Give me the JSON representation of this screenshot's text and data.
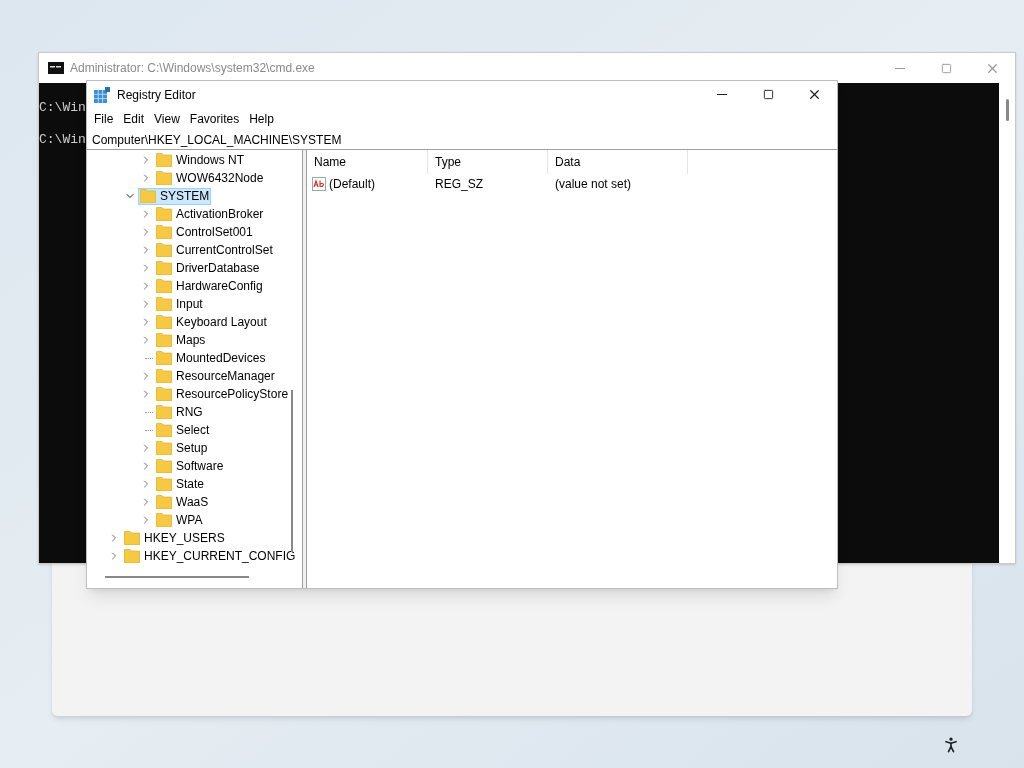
{
  "console_window": {
    "title": "Administrator: C:\\Windows\\system32\\cmd.exe",
    "lines": [
      "C:\\Win",
      "C:\\Win"
    ]
  },
  "registry_window": {
    "title": "Registry Editor",
    "menu": [
      "File",
      "Edit",
      "View",
      "Favorites",
      "Help"
    ],
    "address": "Computer\\HKEY_LOCAL_MACHINE\\SYSTEM",
    "tree": {
      "items": [
        {
          "children": [
            {
              "children": [
                {
                  "label": "Windows NT",
                  "expandable": true,
                  "expanded": false,
                  "selected": false
                },
                {
                  "label": "WOW6432Node",
                  "expandable": true,
                  "expanded": false,
                  "selected": false
                }
              ]
            },
            {
              "label": "SYSTEM",
              "expandable": true,
              "expanded": true,
              "selected": true,
              "children": [
                {
                  "label": "ActivationBroker",
                  "expandable": true,
                  "expanded": false,
                  "selected": false
                },
                {
                  "label": "ControlSet001",
                  "expandable": true,
                  "expanded": false,
                  "selected": false
                },
                {
                  "label": "CurrentControlSet",
                  "expandable": true,
                  "expanded": false,
                  "selected": false
                },
                {
                  "label": "DriverDatabase",
                  "expandable": true,
                  "expanded": false,
                  "selected": false
                },
                {
                  "label": "HardwareConfig",
                  "expandable": true,
                  "expanded": false,
                  "selected": false
                },
                {
                  "label": "Input",
                  "expandable": true,
                  "expanded": false,
                  "selected": false
                },
                {
                  "label": "Keyboard Layout",
                  "expandable": true,
                  "expanded": false,
                  "selected": false
                },
                {
                  "label": "Maps",
                  "expandable": true,
                  "expanded": false,
                  "selected": false
                },
                {
                  "label": "MountedDevices",
                  "expandable": false,
                  "selected": false
                },
                {
                  "label": "ResourceManager",
                  "expandable": true,
                  "expanded": false,
                  "selected": false
                },
                {
                  "label": "ResourcePolicyStore",
                  "expandable": true,
                  "expanded": false,
                  "selected": false
                },
                {
                  "label": "RNG",
                  "expandable": false,
                  "selected": false
                },
                {
                  "label": "Select",
                  "expandable": false,
                  "selected": false
                },
                {
                  "label": "Setup",
                  "expandable": true,
                  "expanded": false,
                  "selected": false
                },
                {
                  "label": "Software",
                  "expandable": true,
                  "expanded": false,
                  "selected": false
                },
                {
                  "label": "State",
                  "expandable": true,
                  "expanded": false,
                  "selected": false
                },
                {
                  "label": "WaaS",
                  "expandable": true,
                  "expanded": false,
                  "selected": false
                },
                {
                  "label": "WPA",
                  "expandable": true,
                  "expanded": false,
                  "selected": false
                }
              ]
            }
          ]
        },
        {
          "label": "HKEY_USERS",
          "expandable": true,
          "expanded": false,
          "selected": false
        },
        {
          "label": "HKEY_CURRENT_CONFIG",
          "expandable": true,
          "expanded": false,
          "selected": false
        }
      ]
    },
    "values": {
      "columns": [
        "Name",
        "Type",
        "Data"
      ],
      "rows": [
        {
          "name": "(Default)",
          "type": "REG_SZ",
          "data": "(value not set)"
        }
      ]
    }
  }
}
